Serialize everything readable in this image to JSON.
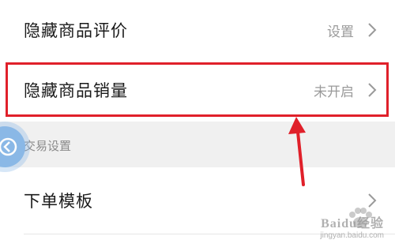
{
  "settings": {
    "rows": [
      {
        "label": "隐藏商品评价",
        "value": "设置"
      },
      {
        "label": "隐藏商品销量",
        "value": "未开启"
      },
      {
        "label": "下单模板",
        "value": ""
      }
    ],
    "section_title": "交易设置"
  },
  "annotation": {
    "highlight_color": "#e0202a",
    "arrow_color": "#e0202a"
  },
  "watermark": {
    "brand": "Baidu经验",
    "url": "jingyan.baidu.com"
  },
  "icons": {
    "chevron": "chevron-right-icon",
    "back": "back-circle-icon"
  }
}
